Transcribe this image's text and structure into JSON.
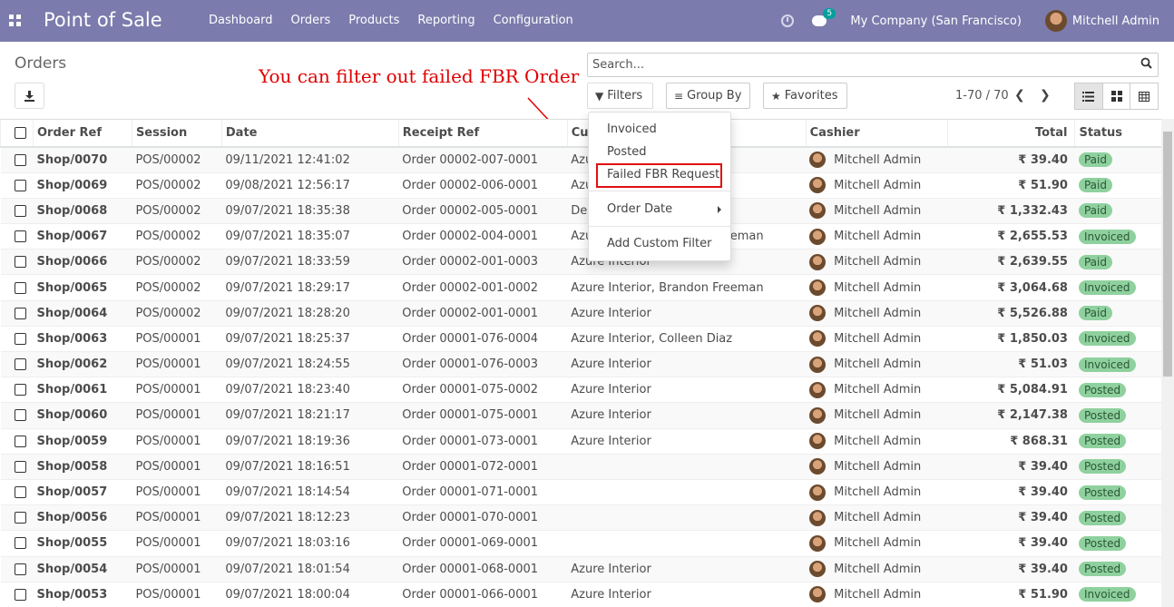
{
  "navbar": {
    "app_title": "Point of Sale",
    "menu": [
      "Dashboard",
      "Orders",
      "Products",
      "Reporting",
      "Configuration"
    ],
    "message_count": "5",
    "company": "My Company (San Francisco)",
    "user": "Mitchell Admin"
  },
  "control_panel": {
    "title": "Orders",
    "annotation": "You can filter out failed FBR Order",
    "search_placeholder": "Search...",
    "filters_label": "Filters",
    "groupby_label": "Group By",
    "favorites_label": "Favorites",
    "pager": "1-70 / 70"
  },
  "filters_menu": {
    "items": [
      "Invoiced",
      "Posted",
      "Failed FBR Request"
    ],
    "order_date": "Order Date",
    "custom_filter": "Add Custom Filter"
  },
  "table": {
    "columns": [
      "Order Ref",
      "Session",
      "Date",
      "Receipt Ref",
      "Cu",
      "Cashier",
      "Total",
      "Status"
    ],
    "rows": [
      {
        "ref": "Shop/0070",
        "session": "POS/00002",
        "date": "09/11/2021 12:41:02",
        "receipt": "Order 00002-007-0001",
        "customer": "Azure Interior",
        "cashier": "Mitchell Admin",
        "total": "₹ 39.40",
        "status": "Paid"
      },
      {
        "ref": "Shop/0069",
        "session": "POS/00002",
        "date": "09/08/2021 12:56:17",
        "receipt": "Order 00002-006-0001",
        "customer": "Azure Interior",
        "cashier": "Mitchell Admin",
        "total": "₹ 51.90",
        "status": "Paid"
      },
      {
        "ref": "Shop/0068",
        "session": "POS/00002",
        "date": "09/07/2021 18:35:38",
        "receipt": "Order 00002-005-0001",
        "customer": "Deco Addict",
        "cashier": "Mitchell Admin",
        "total": "₹ 1,332.43",
        "status": "Paid"
      },
      {
        "ref": "Shop/0067",
        "session": "POS/00002",
        "date": "09/07/2021 18:35:07",
        "receipt": "Order 00002-004-0001",
        "customer": "Azure Interior, Brandon Freeman",
        "cashier": "Mitchell Admin",
        "total": "₹ 2,655.53",
        "status": "Invoiced"
      },
      {
        "ref": "Shop/0066",
        "session": "POS/00002",
        "date": "09/07/2021 18:33:59",
        "receipt": "Order 00002-001-0003",
        "customer": "Azure Interior",
        "cashier": "Mitchell Admin",
        "total": "₹ 2,639.55",
        "status": "Paid"
      },
      {
        "ref": "Shop/0065",
        "session": "POS/00002",
        "date": "09/07/2021 18:29:17",
        "receipt": "Order 00002-001-0002",
        "customer": "Azure Interior, Brandon Freeman",
        "cashier": "Mitchell Admin",
        "total": "₹ 3,064.68",
        "status": "Invoiced"
      },
      {
        "ref": "Shop/0064",
        "session": "POS/00002",
        "date": "09/07/2021 18:28:20",
        "receipt": "Order 00002-001-0001",
        "customer": "Azure Interior",
        "cashier": "Mitchell Admin",
        "total": "₹ 5,526.88",
        "status": "Paid"
      },
      {
        "ref": "Shop/0063",
        "session": "POS/00001",
        "date": "09/07/2021 18:25:37",
        "receipt": "Order 00001-076-0004",
        "customer": "Azure Interior, Colleen Diaz",
        "cashier": "Mitchell Admin",
        "total": "₹ 1,850.03",
        "status": "Invoiced"
      },
      {
        "ref": "Shop/0062",
        "session": "POS/00001",
        "date": "09/07/2021 18:24:55",
        "receipt": "Order 00001-076-0003",
        "customer": "Azure Interior",
        "cashier": "Mitchell Admin",
        "total": "₹ 51.03",
        "status": "Invoiced"
      },
      {
        "ref": "Shop/0061",
        "session": "POS/00001",
        "date": "09/07/2021 18:23:40",
        "receipt": "Order 00001-075-0002",
        "customer": "Azure Interior",
        "cashier": "Mitchell Admin",
        "total": "₹ 5,084.91",
        "status": "Posted"
      },
      {
        "ref": "Shop/0060",
        "session": "POS/00001",
        "date": "09/07/2021 18:21:17",
        "receipt": "Order 00001-075-0001",
        "customer": "Azure Interior",
        "cashier": "Mitchell Admin",
        "total": "₹ 2,147.38",
        "status": "Posted"
      },
      {
        "ref": "Shop/0059",
        "session": "POS/00001",
        "date": "09/07/2021 18:19:36",
        "receipt": "Order 00001-073-0001",
        "customer": "Azure Interior",
        "cashier": "Mitchell Admin",
        "total": "₹ 868.31",
        "status": "Posted"
      },
      {
        "ref": "Shop/0058",
        "session": "POS/00001",
        "date": "09/07/2021 18:16:51",
        "receipt": "Order 00001-072-0001",
        "customer": "",
        "cashier": "Mitchell Admin",
        "total": "₹ 39.40",
        "status": "Posted"
      },
      {
        "ref": "Shop/0057",
        "session": "POS/00001",
        "date": "09/07/2021 18:14:54",
        "receipt": "Order 00001-071-0001",
        "customer": "",
        "cashier": "Mitchell Admin",
        "total": "₹ 39.40",
        "status": "Posted"
      },
      {
        "ref": "Shop/0056",
        "session": "POS/00001",
        "date": "09/07/2021 18:12:23",
        "receipt": "Order 00001-070-0001",
        "customer": "",
        "cashier": "Mitchell Admin",
        "total": "₹ 39.40",
        "status": "Posted"
      },
      {
        "ref": "Shop/0055",
        "session": "POS/00001",
        "date": "09/07/2021 18:03:16",
        "receipt": "Order 00001-069-0001",
        "customer": "",
        "cashier": "Mitchell Admin",
        "total": "₹ 39.40",
        "status": "Posted"
      },
      {
        "ref": "Shop/0054",
        "session": "POS/00001",
        "date": "09/07/2021 18:01:54",
        "receipt": "Order 00001-068-0001",
        "customer": "Azure Interior",
        "cashier": "Mitchell Admin",
        "total": "₹ 39.40",
        "status": "Posted"
      },
      {
        "ref": "Shop/0053",
        "session": "POS/00001",
        "date": "09/07/2021 18:00:04",
        "receipt": "Order 00001-066-0001",
        "customer": "Azure Interior",
        "cashier": "Mitchell Admin",
        "total": "₹ 51.90",
        "status": "Invoiced"
      }
    ]
  },
  "colors": {
    "navbar": "#7c7bad",
    "badge": "#8fd19e",
    "annotation": "#e00000"
  }
}
